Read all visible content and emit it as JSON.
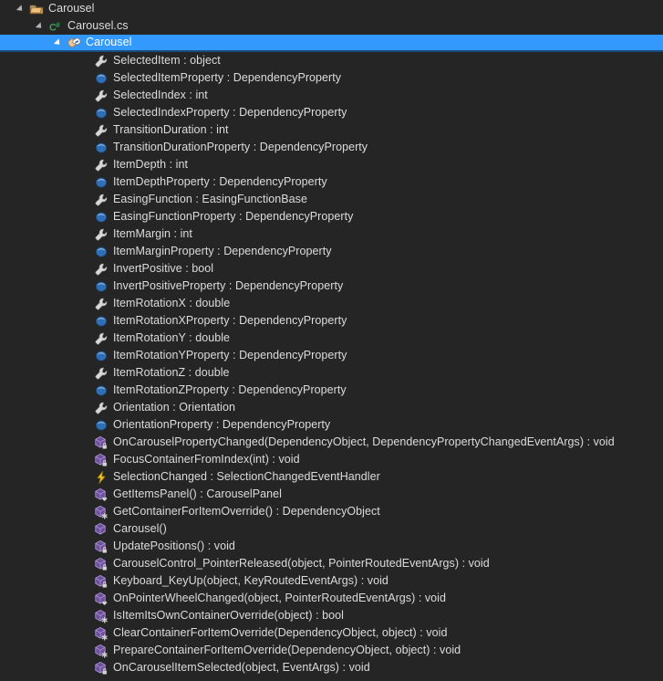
{
  "panel": {
    "name": "class-view-tree",
    "background": "#252526",
    "text_color": "#dcdcdc",
    "selection_color": "#3399FF",
    "selection_border": "#1a4c80"
  },
  "tree": [
    {
      "level": 0,
      "twisty": "open",
      "icon": "project-folder-icon",
      "label": "Carousel",
      "selected": false
    },
    {
      "level": 1,
      "twisty": "open",
      "icon": "csharp-file-icon",
      "label": "Carousel.cs",
      "selected": false
    },
    {
      "level": 2,
      "twisty": "open",
      "icon": "class-icon",
      "label": "Carousel",
      "selected": true
    },
    {
      "level": 3,
      "twisty": "none",
      "icon": "property-icon",
      "label": "SelectedItem : object",
      "selected": false
    },
    {
      "level": 3,
      "twisty": "none",
      "icon": "field-icon",
      "label": "SelectedItemProperty : DependencyProperty",
      "selected": false
    },
    {
      "level": 3,
      "twisty": "none",
      "icon": "property-icon",
      "label": "SelectedIndex : int",
      "selected": false
    },
    {
      "level": 3,
      "twisty": "none",
      "icon": "field-icon",
      "label": "SelectedIndexProperty : DependencyProperty",
      "selected": false
    },
    {
      "level": 3,
      "twisty": "none",
      "icon": "property-icon",
      "label": "TransitionDuration : int",
      "selected": false
    },
    {
      "level": 3,
      "twisty": "none",
      "icon": "field-icon",
      "label": "TransitionDurationProperty : DependencyProperty",
      "selected": false
    },
    {
      "level": 3,
      "twisty": "none",
      "icon": "property-icon",
      "label": "ItemDepth : int",
      "selected": false
    },
    {
      "level": 3,
      "twisty": "none",
      "icon": "field-icon",
      "label": "ItemDepthProperty : DependencyProperty",
      "selected": false
    },
    {
      "level": 3,
      "twisty": "none",
      "icon": "property-icon",
      "label": "EasingFunction : EasingFunctionBase",
      "selected": false
    },
    {
      "level": 3,
      "twisty": "none",
      "icon": "field-icon",
      "label": "EasingFunctionProperty : DependencyProperty",
      "selected": false
    },
    {
      "level": 3,
      "twisty": "none",
      "icon": "property-icon",
      "label": "ItemMargin : int",
      "selected": false
    },
    {
      "level": 3,
      "twisty": "none",
      "icon": "field-icon",
      "label": "ItemMarginProperty : DependencyProperty",
      "selected": false
    },
    {
      "level": 3,
      "twisty": "none",
      "icon": "property-icon",
      "label": "InvertPositive : bool",
      "selected": false
    },
    {
      "level": 3,
      "twisty": "none",
      "icon": "field-icon",
      "label": "InvertPositiveProperty : DependencyProperty",
      "selected": false
    },
    {
      "level": 3,
      "twisty": "none",
      "icon": "property-icon",
      "label": "ItemRotationX : double",
      "selected": false
    },
    {
      "level": 3,
      "twisty": "none",
      "icon": "field-icon",
      "label": "ItemRotationXProperty : DependencyProperty",
      "selected": false
    },
    {
      "level": 3,
      "twisty": "none",
      "icon": "property-icon",
      "label": "ItemRotationY : double",
      "selected": false
    },
    {
      "level": 3,
      "twisty": "none",
      "icon": "field-icon",
      "label": "ItemRotationYProperty : DependencyProperty",
      "selected": false
    },
    {
      "level": 3,
      "twisty": "none",
      "icon": "property-icon",
      "label": "ItemRotationZ : double",
      "selected": false
    },
    {
      "level": 3,
      "twisty": "none",
      "icon": "field-icon",
      "label": "ItemRotationZProperty : DependencyProperty",
      "selected": false
    },
    {
      "level": 3,
      "twisty": "none",
      "icon": "property-icon",
      "label": "Orientation : Orientation",
      "selected": false
    },
    {
      "level": 3,
      "twisty": "none",
      "icon": "field-icon",
      "label": "OrientationProperty : DependencyProperty",
      "selected": false
    },
    {
      "level": 3,
      "twisty": "none",
      "icon": "method-private-icon",
      "label": "OnCarouselPropertyChanged(DependencyObject, DependencyPropertyChangedEventArgs) : void",
      "selected": false
    },
    {
      "level": 3,
      "twisty": "none",
      "icon": "method-private-icon",
      "label": "FocusContainerFromIndex(int) : void",
      "selected": false
    },
    {
      "level": 3,
      "twisty": "none",
      "icon": "event-icon",
      "label": "SelectionChanged : SelectionChangedEventHandler",
      "selected": false
    },
    {
      "level": 3,
      "twisty": "none",
      "icon": "method-protected-icon",
      "label": "GetItemsPanel() : CarouselPanel",
      "selected": false
    },
    {
      "level": 3,
      "twisty": "none",
      "icon": "method-override-icon",
      "label": "GetContainerForItemOverride() : DependencyObject",
      "selected": false
    },
    {
      "level": 3,
      "twisty": "none",
      "icon": "method-public-icon",
      "label": "Carousel()",
      "selected": false
    },
    {
      "level": 3,
      "twisty": "none",
      "icon": "method-private-icon",
      "label": "UpdatePositions() : void",
      "selected": false
    },
    {
      "level": 3,
      "twisty": "none",
      "icon": "method-private-icon",
      "label": "CarouselControl_PointerReleased(object, PointerRoutedEventArgs) : void",
      "selected": false
    },
    {
      "level": 3,
      "twisty": "none",
      "icon": "method-private-icon",
      "label": "Keyboard_KeyUp(object, KeyRoutedEventArgs) : void",
      "selected": false
    },
    {
      "level": 3,
      "twisty": "none",
      "icon": "method-protected-icon",
      "label": "OnPointerWheelChanged(object, PointerRoutedEventArgs) : void",
      "selected": false
    },
    {
      "level": 3,
      "twisty": "none",
      "icon": "method-override-icon",
      "label": "IsItemItsOwnContainerOverride(object) : bool",
      "selected": false
    },
    {
      "level": 3,
      "twisty": "none",
      "icon": "method-override-icon",
      "label": "ClearContainerForItemOverride(DependencyObject, object) : void",
      "selected": false
    },
    {
      "level": 3,
      "twisty": "none",
      "icon": "method-override-icon",
      "label": "PrepareContainerForItemOverride(DependencyObject, object) : void",
      "selected": false
    },
    {
      "level": 3,
      "twisty": "none",
      "icon": "method-private-icon",
      "label": "OnCarouselItemSelected(object, EventArgs) : void",
      "selected": false
    }
  ]
}
